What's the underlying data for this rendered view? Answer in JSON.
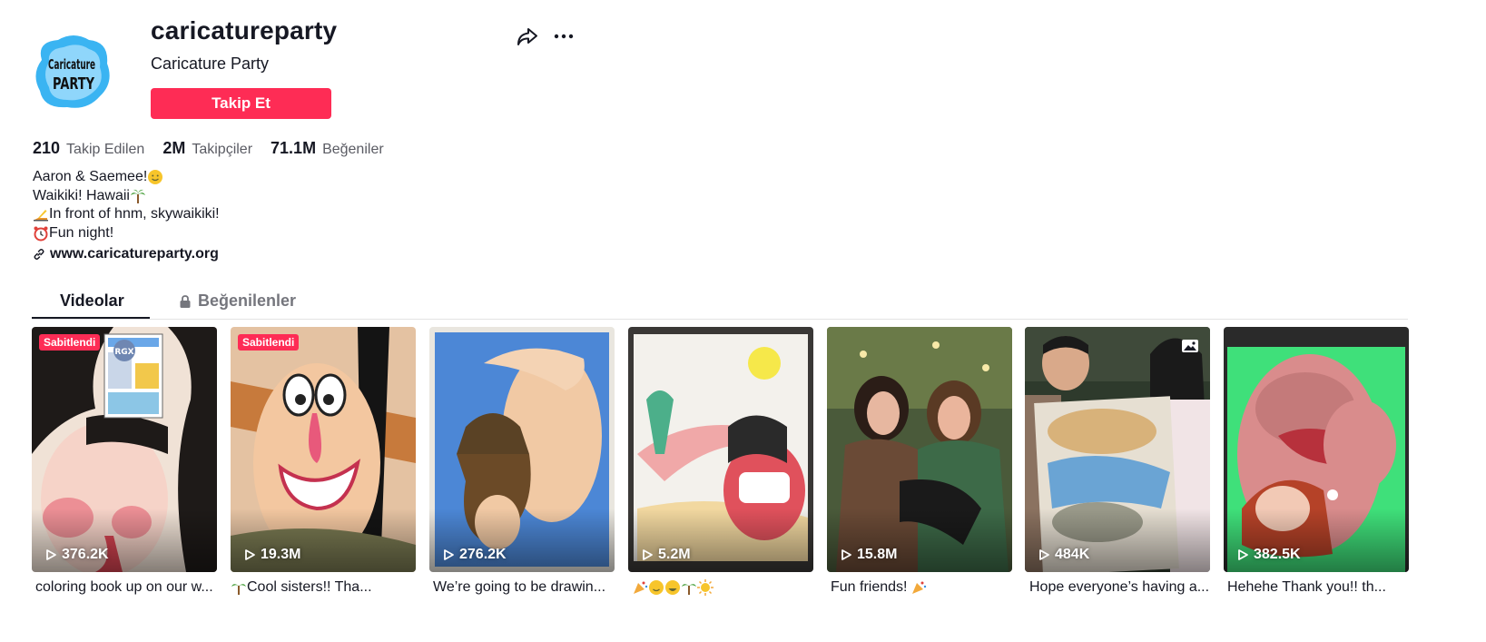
{
  "profile": {
    "username": "caricatureparty",
    "nickname": "Caricature Party",
    "follow_label": "Takip Et",
    "avatar_text_top": "Caricature",
    "avatar_text_bottom": "PARTY"
  },
  "stats": [
    {
      "value": "210",
      "label": "Takip Edilen"
    },
    {
      "value": "2M",
      "label": "Takipçiler"
    },
    {
      "value": "71.1M",
      "label": "Beğeniler"
    }
  ],
  "bio": {
    "line1": "Aaron & Saemee!",
    "line2": "Waikiki! Hawaii",
    "line3": "In front of hnm, skywaikiki!",
    "line4": "Fun night!"
  },
  "link": "www.caricatureparty.org",
  "tabs": {
    "videos": "Videolar",
    "liked": "Beğenilenler"
  },
  "videos": [
    {
      "views": "376.2K",
      "pinned": "Sabitlendi",
      "caption": "coloring book up on our w...",
      "overlay_badge": "RGX"
    },
    {
      "views": "19.3M",
      "pinned": "Sabitlendi",
      "caption": "Cool sisters!! Tha..."
    },
    {
      "views": "276.2K",
      "pinned": "",
      "caption": "We’re going to be drawin..."
    },
    {
      "views": "5.2M",
      "pinned": "",
      "caption": ""
    },
    {
      "views": "15.8M",
      "pinned": "",
      "caption": "Fun friends!"
    },
    {
      "views": "484K",
      "pinned": "",
      "caption": "Hope everyone’s having a..."
    },
    {
      "views": "382.5K",
      "pinned": "",
      "caption": "Hehehe Thank you!! th..."
    }
  ],
  "colors": {
    "brand": "#fe2c55",
    "text": "#161823",
    "muted": "#5a5b63"
  },
  "icons": [
    "share-icon",
    "more-icon",
    "link-icon",
    "lock-icon",
    "play-icon",
    "photo-icon"
  ]
}
